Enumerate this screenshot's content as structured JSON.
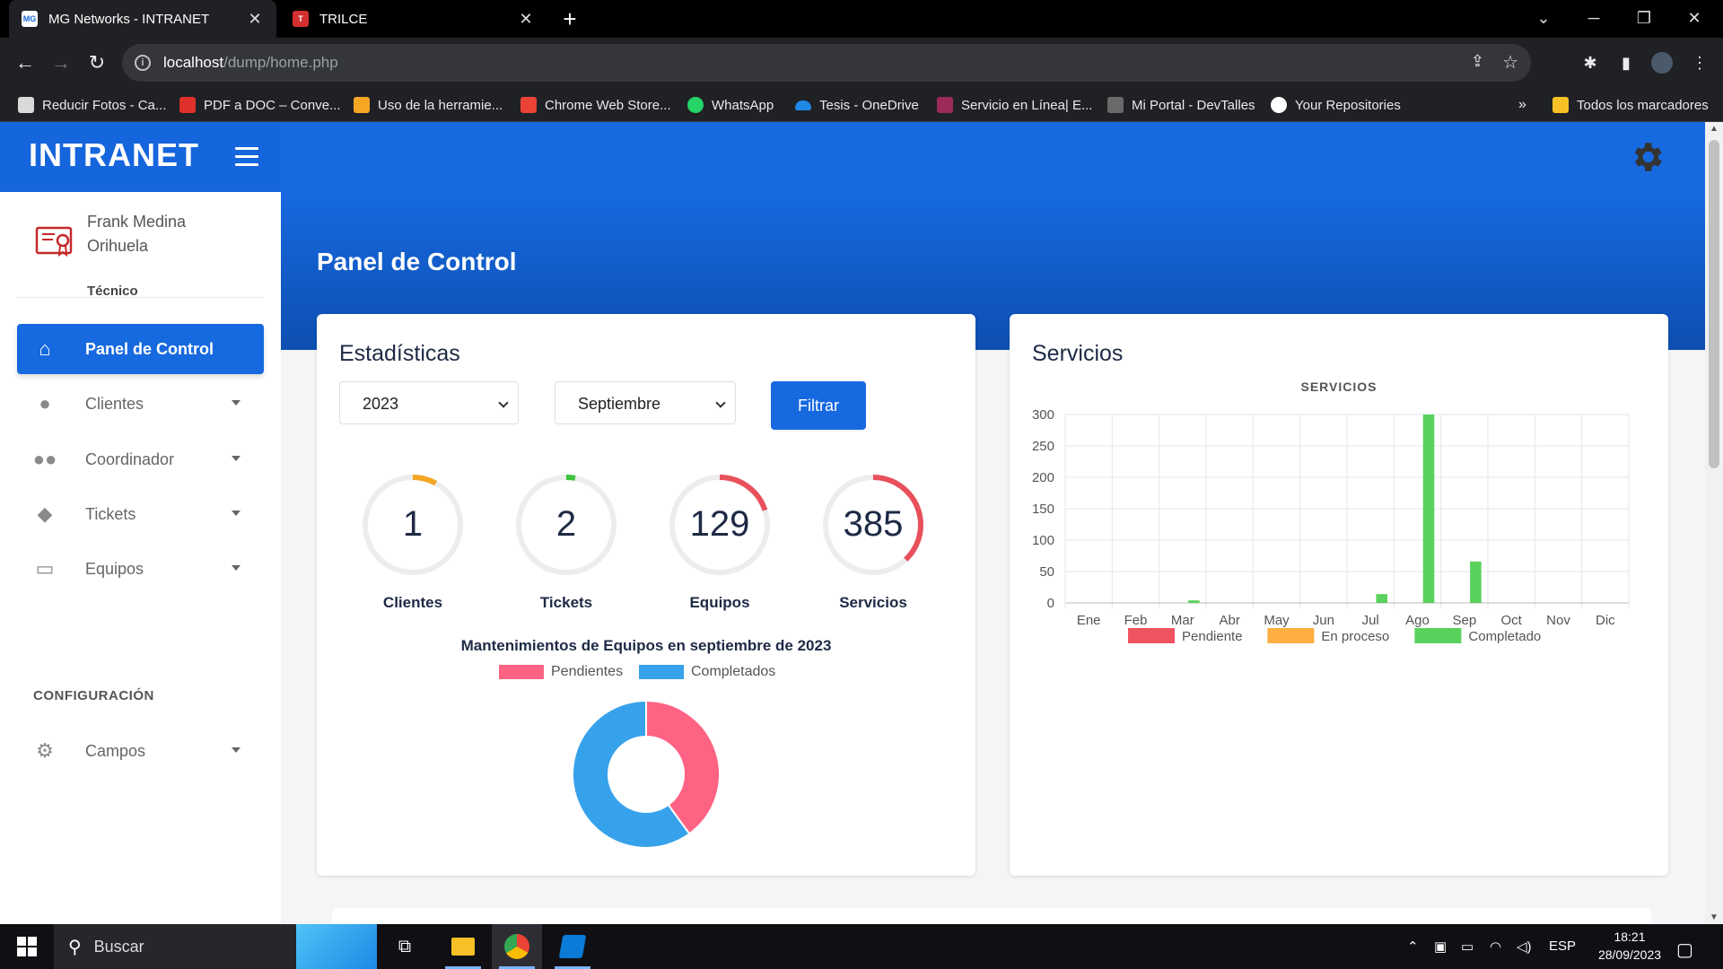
{
  "browser": {
    "tabs": [
      {
        "title": "MG Networks - INTRANET",
        "favicon_text": "MG",
        "active": true
      },
      {
        "title": "TRILCE",
        "favicon_text": "T",
        "active": false
      }
    ],
    "url_host": "localhost",
    "url_path": "/dump/home.php",
    "bookmarks": [
      {
        "label": "Reducir Fotos - Ca...",
        "color": "#d9d9d9"
      },
      {
        "label": "PDF a DOC – Conve...",
        "color": "#e0302b"
      },
      {
        "label": "Uso de la herramie...",
        "color": "#f5a623"
      },
      {
        "label": "Chrome Web Store...",
        "color": "#ea4335"
      },
      {
        "label": "WhatsApp",
        "color": "#25d366"
      },
      {
        "label": "Tesis - OneDrive",
        "color": "#1e88e5"
      },
      {
        "label": "Servicio en Línea| E...",
        "color": "#9c2a5a"
      },
      {
        "label": "Mi Portal - DevTalles",
        "color": "#6a6a6a"
      },
      {
        "label": "Your Repositories",
        "color": "#ffffff"
      }
    ],
    "bookmarks_overflow": "»",
    "all_bookmarks": "Todos los marcadores"
  },
  "app": {
    "brand": "INTRANET",
    "page_title": "Panel de Control",
    "user": {
      "name_line1": "Frank Medina",
      "name_line2": "Orihuela",
      "role": "Técnico"
    },
    "menu": [
      {
        "label": "Panel de Control",
        "icon": "home-icon",
        "active": true
      },
      {
        "label": "Clientes",
        "icon": "user-icon"
      },
      {
        "label": "Coordinador",
        "icon": "users-icon"
      },
      {
        "label": "Tickets",
        "icon": "tag-icon"
      },
      {
        "label": "Equipos",
        "icon": "laptop-icon"
      }
    ],
    "section_label": "CONFIGURACIÓN",
    "config_menu": [
      {
        "label": "Campos",
        "icon": "gear-icon"
      }
    ]
  },
  "stats": {
    "title": "Estadísticas",
    "year": "2023",
    "month": "Septiembre",
    "filter_label": "Filtrar",
    "gauges": [
      {
        "label": "Clientes",
        "value": "1",
        "fraction": 0.08,
        "color": "#f5a524"
      },
      {
        "label": "Tickets",
        "value": "2",
        "fraction": 0.03,
        "color": "#3bc43b"
      },
      {
        "label": "Equipos",
        "value": "129",
        "fraction": 0.2,
        "color": "#e8505b"
      },
      {
        "label": "Servicios",
        "value": "385",
        "fraction": 0.38,
        "color": "#e8505b"
      }
    ],
    "donut_title": "Mantenimientos de Equipos en septiembre de 2023",
    "donut_legend": [
      {
        "label": "Pendientes",
        "color": "#ff6384"
      },
      {
        "label": "Completados",
        "color": "#36a2eb"
      }
    ],
    "donut_fractions": [
      0.4,
      0.6
    ]
  },
  "services": {
    "title": "Servicios",
    "chart_data": {
      "type": "bar",
      "title": "SERVICIOS",
      "categories": [
        "Ene",
        "Feb",
        "Mar",
        "Abr",
        "May",
        "Jun",
        "Jul",
        "Ago",
        "Sep",
        "Oct",
        "Nov",
        "Dic"
      ],
      "series": [
        {
          "name": "Pendiente",
          "color": "#ef5360",
          "values": [
            0,
            0,
            0,
            0,
            0,
            0,
            0,
            0,
            0,
            0,
            0,
            0
          ]
        },
        {
          "name": "En proceso",
          "color": "#ffae42",
          "values": [
            0,
            0,
            0,
            0,
            0,
            0,
            0,
            0,
            0,
            0,
            0,
            0
          ]
        },
        {
          "name": "Completado",
          "color": "#59d15c",
          "values": [
            0,
            0,
            4,
            0,
            0,
            0,
            14,
            300,
            66,
            0,
            0,
            0
          ]
        }
      ],
      "yticks": [
        0,
        50,
        100,
        150,
        200,
        250,
        300
      ],
      "ylim": [
        0,
        300
      ],
      "grid": true,
      "legend_position": "bottom"
    }
  },
  "taskbar": {
    "search_placeholder": "Buscar",
    "language": "ESP",
    "time": "18:21",
    "date": "28/09/2023"
  }
}
